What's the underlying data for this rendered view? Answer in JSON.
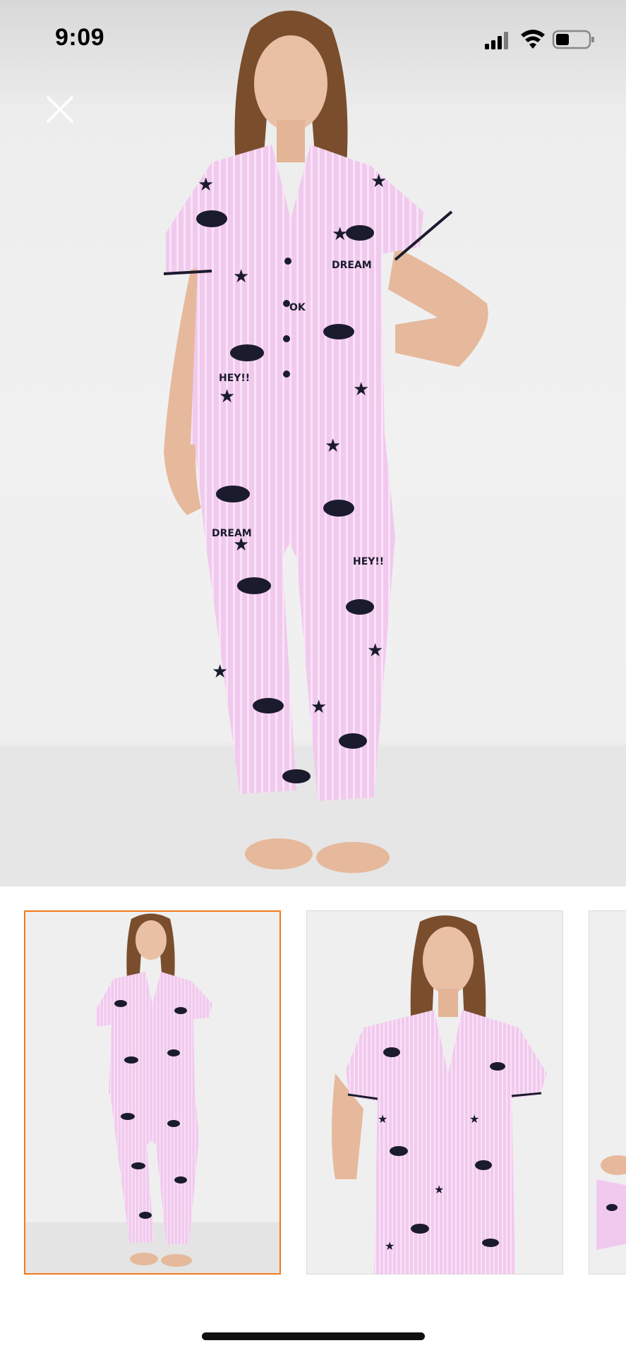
{
  "status_bar": {
    "time": "9:09",
    "icons": [
      "cellular-signal-icon",
      "wifi-icon",
      "battery-icon"
    ]
  },
  "close_button": {
    "icon": "close-icon"
  },
  "hero_image": {
    "subject": "product-photo",
    "print_text": [
      "HEY!!",
      "DREAM",
      "OK"
    ]
  },
  "thumbnails": {
    "selected_index": 0,
    "items": [
      {
        "view": "full-body"
      },
      {
        "view": "upper-body"
      },
      {
        "view": "detail"
      }
    ]
  },
  "colors": {
    "accent": "#f27a1a",
    "pajama": "#f1c9ee",
    "print_dark": "#1b1b2e",
    "background": "#ffffff"
  }
}
